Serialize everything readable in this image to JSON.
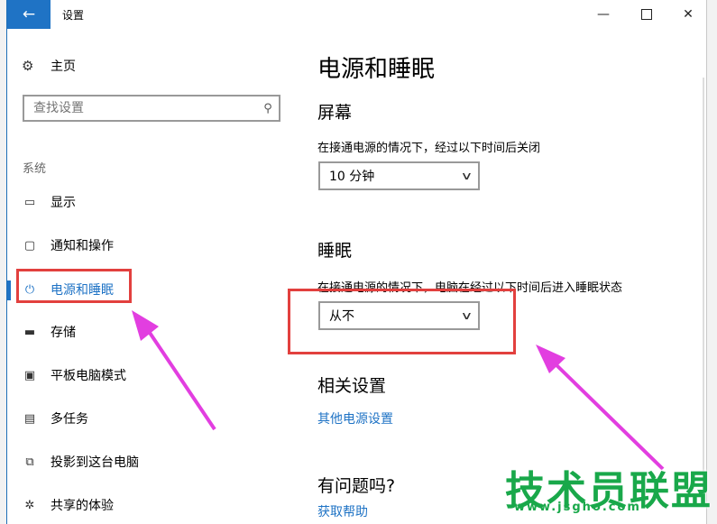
{
  "window": {
    "title": "设置"
  },
  "titlebar": {
    "back_glyph": "←",
    "min_glyph": "—",
    "close_glyph": "✕"
  },
  "sidebar": {
    "home": "主页",
    "search_placeholder": "查找设置",
    "section": "系统",
    "items": [
      {
        "label": "显示",
        "icon": "monitor-icon",
        "active": false
      },
      {
        "label": "通知和操作",
        "icon": "notification-icon",
        "active": false
      },
      {
        "label": "电源和睡眠",
        "icon": "power-icon",
        "active": true
      },
      {
        "label": "存储",
        "icon": "storage-icon",
        "active": false
      },
      {
        "label": "平板电脑模式",
        "icon": "tablet-icon",
        "active": false
      },
      {
        "label": "多任务",
        "icon": "multitask-icon",
        "active": false
      },
      {
        "label": "投影到这台电脑",
        "icon": "project-icon",
        "active": false
      },
      {
        "label": "共享的体验",
        "icon": "share-icon",
        "active": false
      }
    ]
  },
  "main": {
    "title": "电源和睡眠",
    "screen": {
      "heading": "屏幕",
      "desc": "在接通电源的情况下，经过以下时间后关闭",
      "value": "10 分钟"
    },
    "sleep": {
      "heading": "睡眠",
      "desc": "在接通电源的情况下，电脑在经过以下时间后进入睡眠状态",
      "value": "从不"
    },
    "related": {
      "heading": "相关设置",
      "link": "其他电源设置"
    },
    "help": {
      "heading": "有问题吗?",
      "link": "获取帮助"
    }
  },
  "watermark": {
    "text": "技术员联盟",
    "url": "www.jsgho.com"
  },
  "colors": {
    "accent": "#1f73c5",
    "highlight": "#e2403e",
    "arrow": "#e23ee0",
    "watermark": "#19a84a"
  }
}
